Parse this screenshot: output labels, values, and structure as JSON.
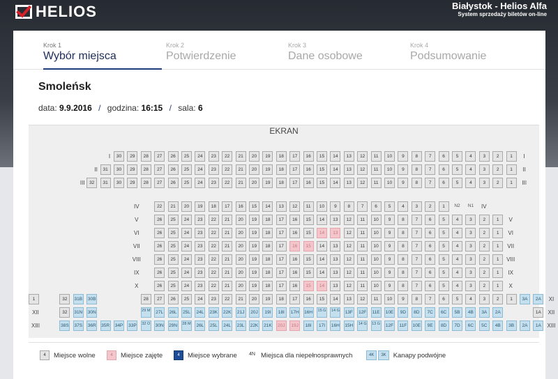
{
  "header": {
    "logo_text": "HELIOS",
    "logo_icon": "checkmark-icon",
    "city": "Białystok - Helios Alfa",
    "tagline": "System sprzedaży biletów on-line",
    "accent": "#d6202a"
  },
  "steps": [
    {
      "num": "Krok 1",
      "label": "Wybór miejsca",
      "active": true
    },
    {
      "num": "Krok 2",
      "label": "Potwierdzenie",
      "active": false
    },
    {
      "num": "Krok 3",
      "label": "Dane osobowe",
      "active": false
    },
    {
      "num": "Krok 4",
      "label": "Podsumowanie",
      "active": false
    }
  ],
  "movie": {
    "title": "Smoleńsk"
  },
  "info": {
    "date_label": "data:",
    "date": "9.9.2016",
    "time_label": "godzina:",
    "time": "16:15",
    "hall_label": "sala:",
    "hall": "6",
    "separator": "/"
  },
  "screen_label": "EKRAN",
  "colors": {
    "free": "#e4e4e4",
    "taken": "#f4c6cb",
    "selected": "#1d4d96",
    "sofa": "#c4e0ef"
  },
  "rows": [
    {
      "label": "I",
      "seats": [
        "30",
        "29",
        "28",
        "27",
        "26",
        "25",
        "24",
        "23",
        "22",
        "21",
        "20",
        "19",
        "18",
        "17",
        "16",
        "15",
        "14",
        "13",
        "12",
        "11",
        "10",
        "9",
        "8",
        "7",
        "6",
        "5",
        "4",
        "3",
        "2",
        "1"
      ]
    },
    {
      "label": "II",
      "seats": [
        "31",
        "30",
        "29",
        "28",
        "27",
        "26",
        "25",
        "24",
        "23",
        "22",
        "21",
        "20",
        "19",
        "18",
        "17",
        "16",
        "15",
        "14",
        "13",
        "12",
        "11",
        "10",
        "9",
        "8",
        "7",
        "6",
        "5",
        "4",
        "3",
        "2",
        "1"
      ]
    },
    {
      "label": "III",
      "seats": [
        "32",
        "31",
        "30",
        "29",
        "28",
        "27",
        "26",
        "25",
        "24",
        "23",
        "22",
        "21",
        "20",
        "19",
        "18",
        "17",
        "16",
        "15",
        "14",
        "13",
        "12",
        "11",
        "10",
        "9",
        "8",
        "7",
        "6",
        "5",
        "4",
        "3",
        "2",
        "1"
      ]
    },
    {
      "label": "IV",
      "seats": [
        "22",
        "21",
        "20",
        "19",
        "18",
        "17",
        "16",
        "15",
        "14",
        "13",
        "12",
        "11",
        "10",
        "9",
        "8",
        "7",
        "6",
        "5",
        "4",
        "3",
        "2",
        "1",
        "N2",
        "N1"
      ]
    },
    {
      "label": "V",
      "seats": [
        "26",
        "25",
        "24",
        "23",
        "22",
        "21",
        "20",
        "19",
        "18",
        "17",
        "16",
        "15",
        "14",
        "13",
        "12",
        "11",
        "10",
        "9",
        "8",
        "7",
        "6",
        "5",
        "4",
        "3",
        "2",
        "1"
      ]
    },
    {
      "label": "VI",
      "seats": [
        "26",
        "25",
        "24",
        "23",
        "22",
        "21",
        "20",
        "19",
        "18",
        "17",
        "16",
        "15",
        "14",
        "13",
        "12",
        "11",
        "10",
        "9",
        "8",
        "7",
        "6",
        "5",
        "4",
        "3",
        "2",
        "1"
      ],
      "taken": [
        "14",
        "13"
      ]
    },
    {
      "label": "VII",
      "seats": [
        "26",
        "25",
        "24",
        "23",
        "22",
        "21",
        "20",
        "19",
        "18",
        "17",
        "16",
        "15",
        "14",
        "13",
        "12",
        "11",
        "10",
        "9",
        "8",
        "7",
        "6",
        "5",
        "4",
        "3",
        "2",
        "1"
      ],
      "taken": [
        "16",
        "15"
      ]
    },
    {
      "label": "VIII",
      "seats": [
        "26",
        "25",
        "24",
        "23",
        "22",
        "21",
        "20",
        "19",
        "18",
        "17",
        "16",
        "15",
        "14",
        "13",
        "12",
        "11",
        "10",
        "9",
        "8",
        "7",
        "6",
        "5",
        "4",
        "3",
        "2",
        "1"
      ]
    },
    {
      "label": "IX",
      "seats": [
        "26",
        "25",
        "24",
        "23",
        "22",
        "21",
        "20",
        "19",
        "18",
        "17",
        "16",
        "15",
        "14",
        "13",
        "12",
        "11",
        "10",
        "9",
        "8",
        "7",
        "6",
        "5",
        "4",
        "3",
        "2",
        "1"
      ]
    },
    {
      "label": "X",
      "seats": [
        "26",
        "25",
        "24",
        "23",
        "22",
        "21",
        "20",
        "19",
        "18",
        "17",
        "16",
        "15",
        "14",
        "13",
        "12",
        "11",
        "10",
        "9",
        "8",
        "7",
        "6",
        "5",
        "4",
        "3",
        "2",
        "1"
      ],
      "taken": [
        "15",
        "14"
      ]
    },
    {
      "label": "XI",
      "seats": [
        "32",
        "31B",
        "30B",
        "28",
        "27",
        "26",
        "25",
        "24",
        "23",
        "22",
        "21",
        "20",
        "19",
        "18",
        "17",
        "16",
        "15",
        "14",
        "13",
        "12",
        "11",
        "10",
        "9",
        "8",
        "7",
        "6",
        "5",
        "4",
        "3",
        "2",
        "1",
        "3A",
        "2A",
        "1"
      ],
      "sofa": [
        "31B",
        "30B",
        "3A",
        "2A"
      ]
    },
    {
      "label": "XII",
      "seats": [
        "32",
        "31N",
        "30N",
        "29 M",
        "27L",
        "26L",
        "25L",
        "24L",
        "23K",
        "22K",
        "21J",
        "20J",
        "19I",
        "18I",
        "17H",
        "16H",
        "15 G",
        "14 G",
        "13F",
        "12F",
        "11E",
        "10E",
        "9D",
        "8D",
        "7C",
        "6C",
        "5B",
        "4B",
        "3A",
        "2A",
        "1A"
      ],
      "sofa": [
        "31N",
        "30N",
        "29 M",
        "27L",
        "26L",
        "25L",
        "24L",
        "23K",
        "22K",
        "21J",
        "20J",
        "19I",
        "18I",
        "17H",
        "16H",
        "15 G",
        "14 G",
        "13F",
        "12F",
        "11E",
        "10E",
        "9D",
        "8D",
        "7C",
        "6C",
        "5B",
        "4B",
        "3A",
        "2A"
      ]
    },
    {
      "label": "XIII",
      "seats": [
        "38S",
        "37S",
        "36R",
        "35R",
        "34P",
        "33P",
        "32 O",
        "30N",
        "29N",
        "28 M",
        "26L",
        "25L",
        "24L",
        "23L",
        "22K",
        "21K",
        "20J",
        "19J",
        "18I",
        "17I",
        "16H",
        "15H",
        "14 G",
        "13 G",
        "12F",
        "11F",
        "10E",
        "9E",
        "8D",
        "7D",
        "6C",
        "5C",
        "4B",
        "3B",
        "2A",
        "1A"
      ],
      "sofa": [
        "38S",
        "37S",
        "36R",
        "35R",
        "34P",
        "33P",
        "32 O",
        "30N",
        "29N",
        "28 M",
        "26L",
        "25L",
        "24L",
        "23L",
        "22K",
        "21K",
        "18I",
        "17I",
        "16H",
        "15H",
        "14 G",
        "13 G",
        "12F",
        "11F",
        "10E",
        "9E",
        "8D",
        "7D",
        "6C",
        "5C",
        "4B",
        "3B",
        "2A",
        "1A"
      ],
      "taken": [
        "20J",
        "19J"
      ]
    }
  ],
  "legend": [
    {
      "swatch": "4",
      "type": "free",
      "label": "Miejsce wolne"
    },
    {
      "swatch": "4",
      "type": "taken",
      "label": "Miejsce zajęte"
    },
    {
      "swatch": "4",
      "type": "sel",
      "label": "Miejsce wybrane"
    },
    {
      "swatch": "4N",
      "type": "dis",
      "label": "Miejsca dla niepełnosprawnych"
    },
    {
      "swatch": "4K",
      "swatch2": "3K",
      "type": "sofa",
      "label": "Kanapy podwójne"
    }
  ]
}
